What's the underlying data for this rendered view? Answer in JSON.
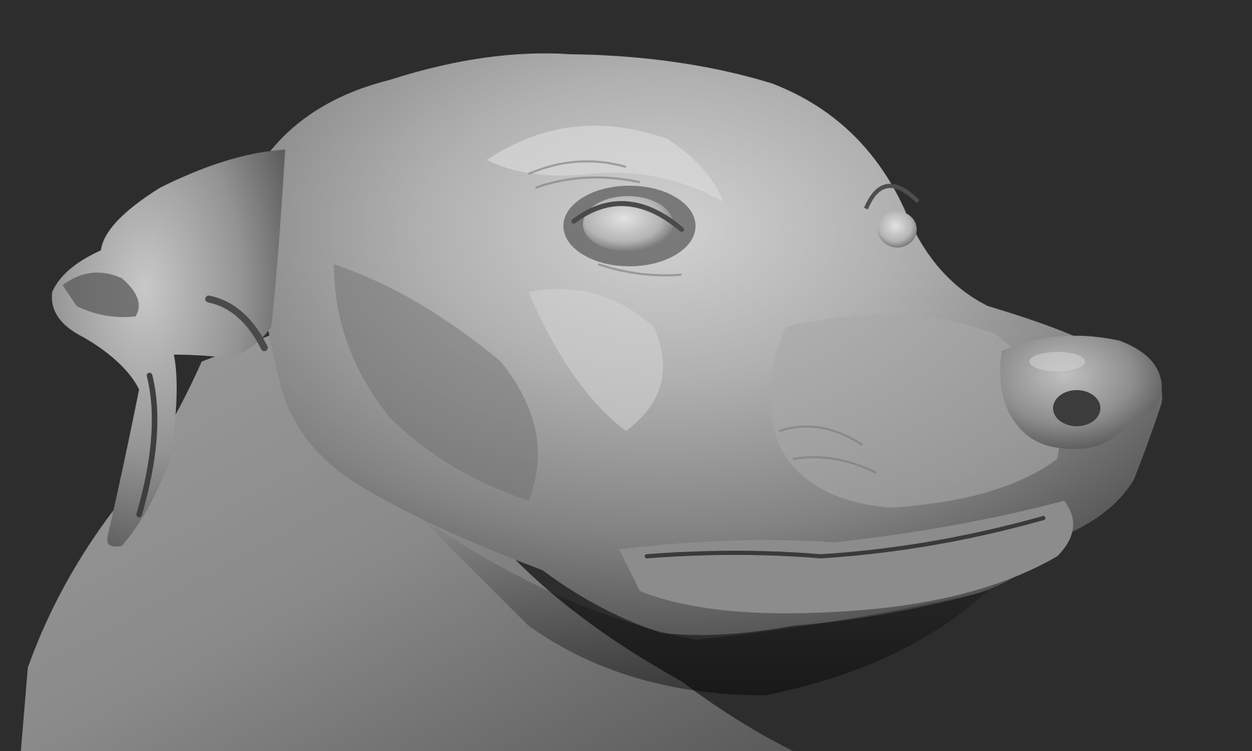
{
  "scene": {
    "subject": "sculpted-dog-head",
    "material": "matte-grey-clay",
    "colors": {
      "background": "#2d2d2d",
      "clay_highlight": "#d8d8d8",
      "clay_mid": "#9a9a9a",
      "clay_shadow": "#4a4a4a",
      "clay_deep": "#333333"
    }
  }
}
